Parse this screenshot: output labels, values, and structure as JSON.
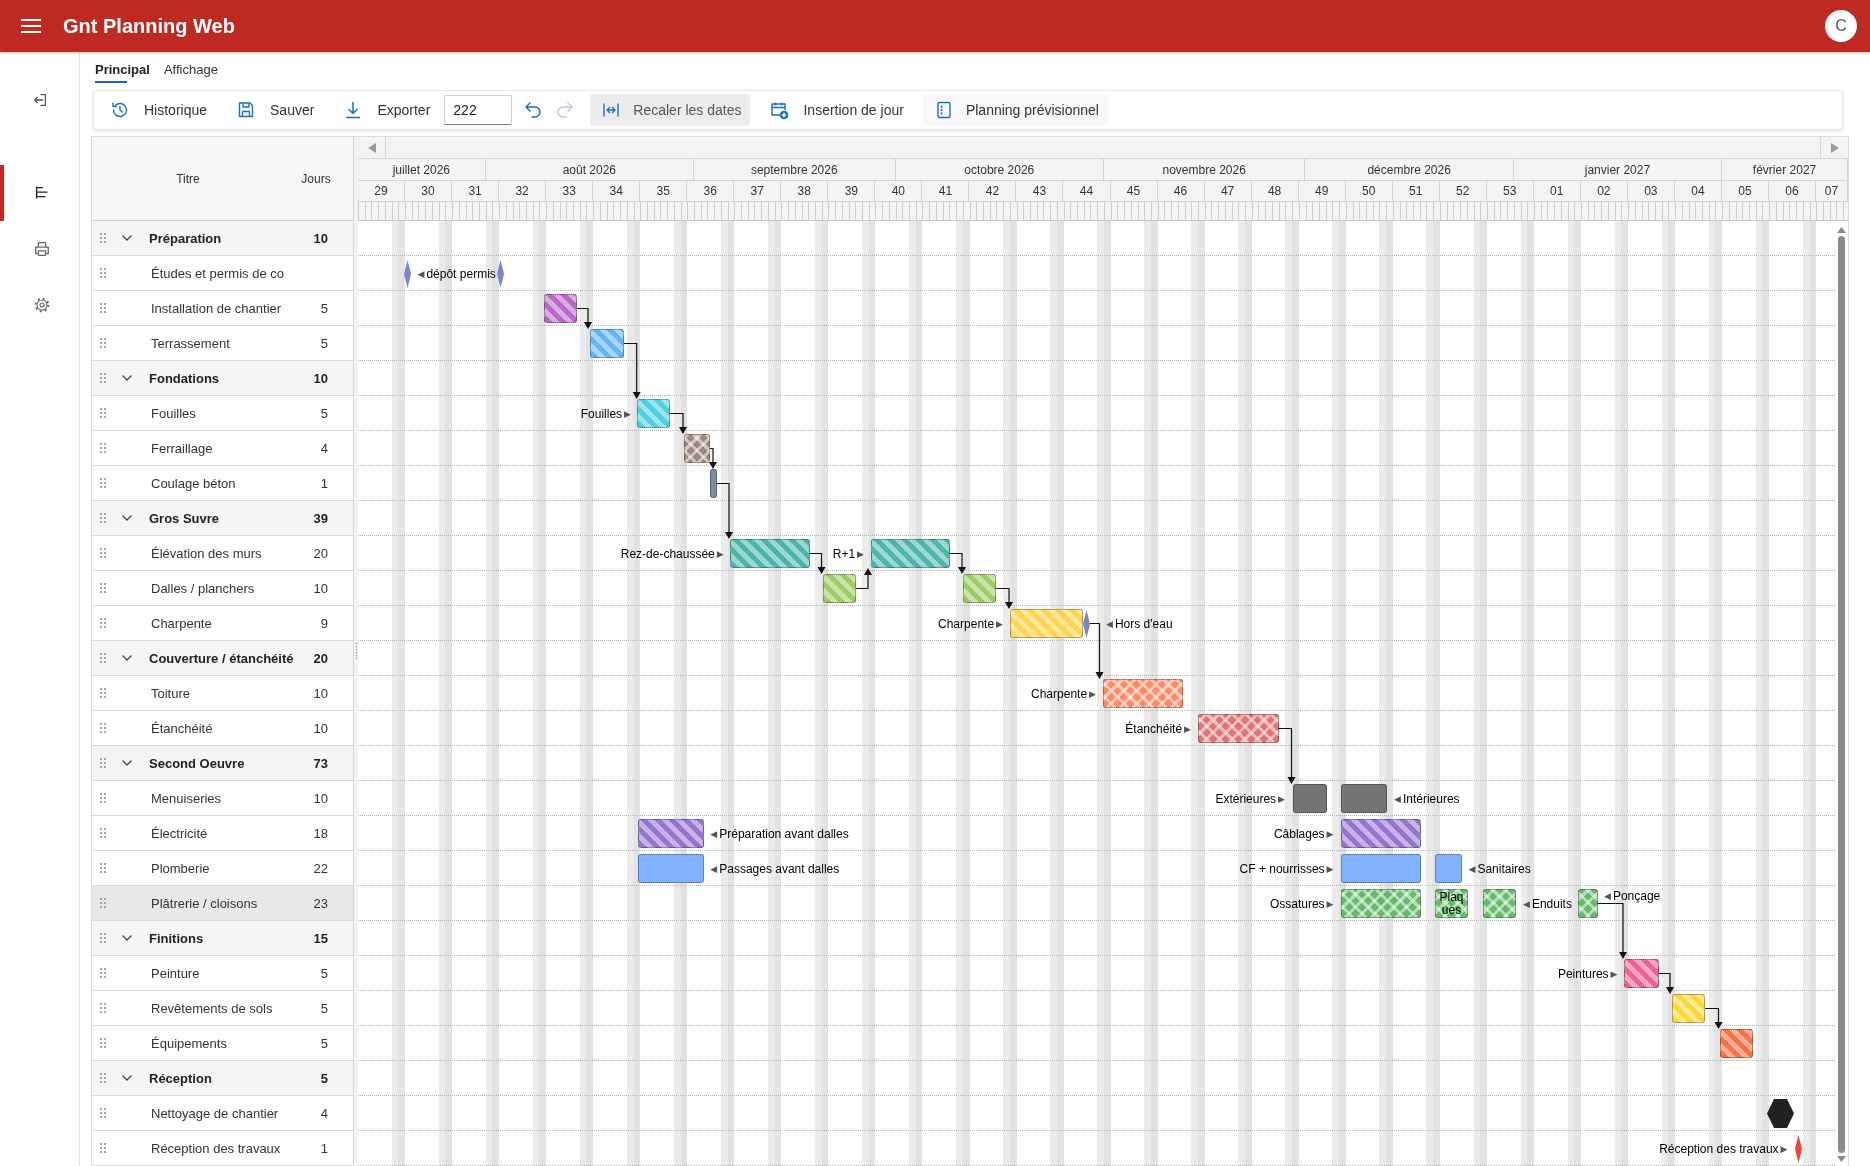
{
  "app_bar": {
    "title": "Gnt Planning Web",
    "avatar": "C"
  },
  "sidebar": {
    "items": [
      {
        "selected": true
      },
      {
        "selected": false
      },
      {
        "selected": false
      }
    ]
  },
  "tabs": [
    {
      "label": "Principal",
      "selected": true
    },
    {
      "label": "Affichage",
      "selected": false
    }
  ],
  "toolbar": [
    {
      "kind": "button",
      "label": "Historique"
    },
    {
      "kind": "button",
      "label": "Sauver"
    },
    {
      "kind": "button",
      "label": "Exporter"
    },
    {
      "kind": "field",
      "value": "222"
    },
    {
      "kind": "icon",
      "disabled": false
    },
    {
      "kind": "icon",
      "disabled": true
    },
    {
      "kind": "toggle",
      "label": "Recaler les dates",
      "checked": true
    },
    {
      "kind": "button",
      "label": "Insertion de jour"
    },
    {
      "kind": "toggle",
      "label": "Planning prévisionnel",
      "checked": false
    }
  ],
  "timeline": {
    "months": [
      "juillet 2026",
      "août 2026",
      "septembre 2026",
      "octobre 2026",
      "novembre 2026",
      "décembre 2026",
      "janvier 2027",
      "février 2027"
    ],
    "weeks": [
      "29",
      "30",
      "31",
      "32",
      "33",
      "34",
      "35",
      "36",
      "37",
      "38",
      "39",
      "40",
      "41",
      "42",
      "43",
      "44",
      "45",
      "46",
      "47",
      "48",
      "49",
      "50",
      "51",
      "52",
      "53",
      "01",
      "02",
      "03",
      "04",
      "05",
      "06",
      "07"
    ]
  },
  "table": {
    "columns": [
      "Titre",
      "Jours"
    ],
    "rows": [
      {
        "title": "Préparation",
        "days": "10",
        "expanded": true,
        "selected": false,
        "children": [
          {
            "title": "Études et permis de co",
            "selected": false,
            "gantt": [
              {
                "kind": "milestone",
                "color": "#7986cb"
              },
              {
                "kind": "label-right",
                "pointer": "◀",
                "text": "dépôt permis"
              },
              {
                "kind": "milestone",
                "color": "#7986cb"
              }
            ]
          },
          {
            "title": "Installation de chantier",
            "days": "5",
            "selected": false,
            "gantt": [
              {
                "kind": "striped",
                "color": "#ba68c8"
              }
            ]
          },
          {
            "title": "Terrassement",
            "days": "5",
            "selected": false,
            "gantt": [
              {
                "kind": "striped",
                "color": "#64b5f6"
              }
            ]
          }
        ]
      },
      {
        "title": "Fondations",
        "days": "10",
        "expanded": true,
        "selected": false,
        "children": [
          {
            "title": "Fouilles",
            "days": "5",
            "selected": false,
            "gantt": [
              {
                "kind": "label-left",
                "pointer": "▶",
                "text": "Fouilles"
              },
              {
                "kind": "striped",
                "color": "#4dd0e1"
              }
            ]
          },
          {
            "title": "Ferraillage",
            "days": "4",
            "selected": false,
            "gantt": [
              {
                "kind": "hatched",
                "color": "#a1887f"
              }
            ]
          },
          {
            "title": "Coulage béton",
            "days": "1",
            "selected": false,
            "gantt": [
              {
                "kind": "solid",
                "color": "#78909c"
              }
            ]
          }
        ]
      },
      {
        "title": "Gros Suvre",
        "days": "39",
        "expanded": true,
        "selected": false,
        "children": [
          {
            "title": "Élévation des murs",
            "days": "20",
            "selected": false,
            "gantt": [
              {
                "kind": "label-left",
                "pointer": "▶",
                "text": "Rez-de-chaussée"
              },
              {
                "kind": "striped",
                "color": "#4db6ac"
              },
              {
                "kind": "label-left",
                "pointer": "▶",
                "text": "R+1"
              },
              {
                "kind": "striped",
                "color": "#4db6ac"
              }
            ]
          },
          {
            "title": "Dalles / planchers",
            "days": "10",
            "selected": false,
            "gantt": [
              {
                "kind": "striped",
                "color": "#9ccc65"
              },
              {
                "kind": "striped",
                "color": "#9ccc65"
              }
            ]
          },
          {
            "title": "Charpente",
            "days": "9",
            "selected": false,
            "gantt": [
              {
                "kind": "label-left",
                "pointer": "▶",
                "text": "Charpente"
              },
              {
                "kind": "striped",
                "color": "#ffd54f"
              },
              {
                "kind": "milestone",
                "color": "#7986cb"
              },
              {
                "kind": "label-right",
                "pointer": "◀",
                "text": "Hors d'eau"
              }
            ]
          }
        ]
      },
      {
        "title": "Couverture / étanchéité",
        "days": "20",
        "expanded": true,
        "selected": false,
        "children": [
          {
            "title": "Toiture",
            "days": "10",
            "selected": false,
            "gantt": [
              {
                "kind": "label-left",
                "pointer": "▶",
                "text": "Charpente"
              },
              {
                "kind": "hatched",
                "color": "#ff8a65"
              }
            ]
          },
          {
            "title": "Étanchéité",
            "days": "10",
            "selected": false,
            "gantt": [
              {
                "kind": "label-left",
                "pointer": "▶",
                "text": "Étanchéité"
              },
              {
                "kind": "hatched",
                "color": "#e57373"
              }
            ]
          }
        ]
      },
      {
        "title": "Second Oeuvre",
        "days": "73",
        "expanded": true,
        "selected": false,
        "children": [
          {
            "title": "Menuiseries",
            "days": "10",
            "selected": false,
            "gantt": [
              {
                "kind": "label-left",
                "pointer": "▶",
                "text": "Extérieures"
              },
              {
                "kind": "solid",
                "color": "#757575"
              },
              {
                "kind": "solid",
                "color": "#757575"
              },
              {
                "kind": "label-right",
                "pointer": "◀",
                "text": "Intérieures"
              }
            ]
          },
          {
            "title": "Électricité",
            "days": "18",
            "selected": false,
            "gantt": [
              {
                "kind": "striped",
                "color": "#9575cd"
              },
              {
                "kind": "label-right",
                "pointer": "◀",
                "text": "Préparation avant dalles"
              },
              {
                "kind": "label-left",
                "pointer": "▶",
                "text": "Câblages"
              },
              {
                "kind": "striped",
                "color": "#9575cd"
              }
            ]
          },
          {
            "title": "Plomberie",
            "days": "22",
            "selected": false,
            "gantt": [
              {
                "kind": "solid",
                "color": "#82b1ff"
              },
              {
                "kind": "label-right",
                "pointer": "◀",
                "text": "Passages avant dalles"
              },
              {
                "kind": "label-left",
                "pointer": "▶",
                "text": "CF + nourrisses"
              },
              {
                "kind": "solid",
                "color": "#82b1ff"
              },
              {
                "kind": "solid",
                "color": "#82b1ff"
              },
              {
                "kind": "label-right",
                "pointer": "◀",
                "text": "Sanitaires"
              }
            ]
          },
          {
            "title": "Plâtrerie / cloisons",
            "days": "23",
            "selected": true,
            "gantt": [
              {
                "kind": "label-left",
                "pointer": "▶",
                "text": "Ossatures"
              },
              {
                "kind": "hatched",
                "color": "#66bb6a"
              },
              {
                "kind": "hatched",
                "color": "#66bb6a",
                "text": "Plaques"
              },
              {
                "kind": "hatched",
                "color": "#66bb6a"
              },
              {
                "kind": "label-right",
                "pointer": "◀",
                "text": "Enduits"
              },
              {
                "kind": "hatched",
                "color": "#66bb6a"
              },
              {
                "kind": "label-right",
                "pointer": "◀",
                "text": "Ponçage"
              }
            ]
          }
        ]
      },
      {
        "title": "Finitions",
        "days": "15",
        "expanded": true,
        "selected": false,
        "children": [
          {
            "title": "Peinture",
            "days": "5",
            "selected": false,
            "gantt": [
              {
                "kind": "label-left",
                "pointer": "▶",
                "text": "Peintures"
              },
              {
                "kind": "striped",
                "color": "#f06292"
              }
            ]
          },
          {
            "title": "Revêtements de sols",
            "days": "5",
            "selected": false,
            "gantt": [
              {
                "kind": "striped",
                "color": "#fdd835"
              }
            ]
          },
          {
            "title": "Équipements",
            "days": "5",
            "selected": false,
            "gantt": [
              {
                "kind": "striped",
                "color": "#ff7043"
              }
            ]
          }
        ]
      },
      {
        "title": "Réception",
        "days": "5",
        "expanded": true,
        "selected": false,
        "children": [
          {
            "title": "Nettoyage de chantier",
            "days": "4",
            "selected": false,
            "gantt": [
              {
                "kind": "hexagon",
                "color": "#212121"
              }
            ]
          },
          {
            "title": "Réception des travaux",
            "days": "1",
            "selected": false,
            "gantt": [
              {
                "kind": "label-left",
                "pointer": "▶",
                "text": "Réception des travaux"
              },
              {
                "kind": "milestone",
                "color": "#f44336"
              }
            ]
          }
        ]
      }
    ]
  }
}
